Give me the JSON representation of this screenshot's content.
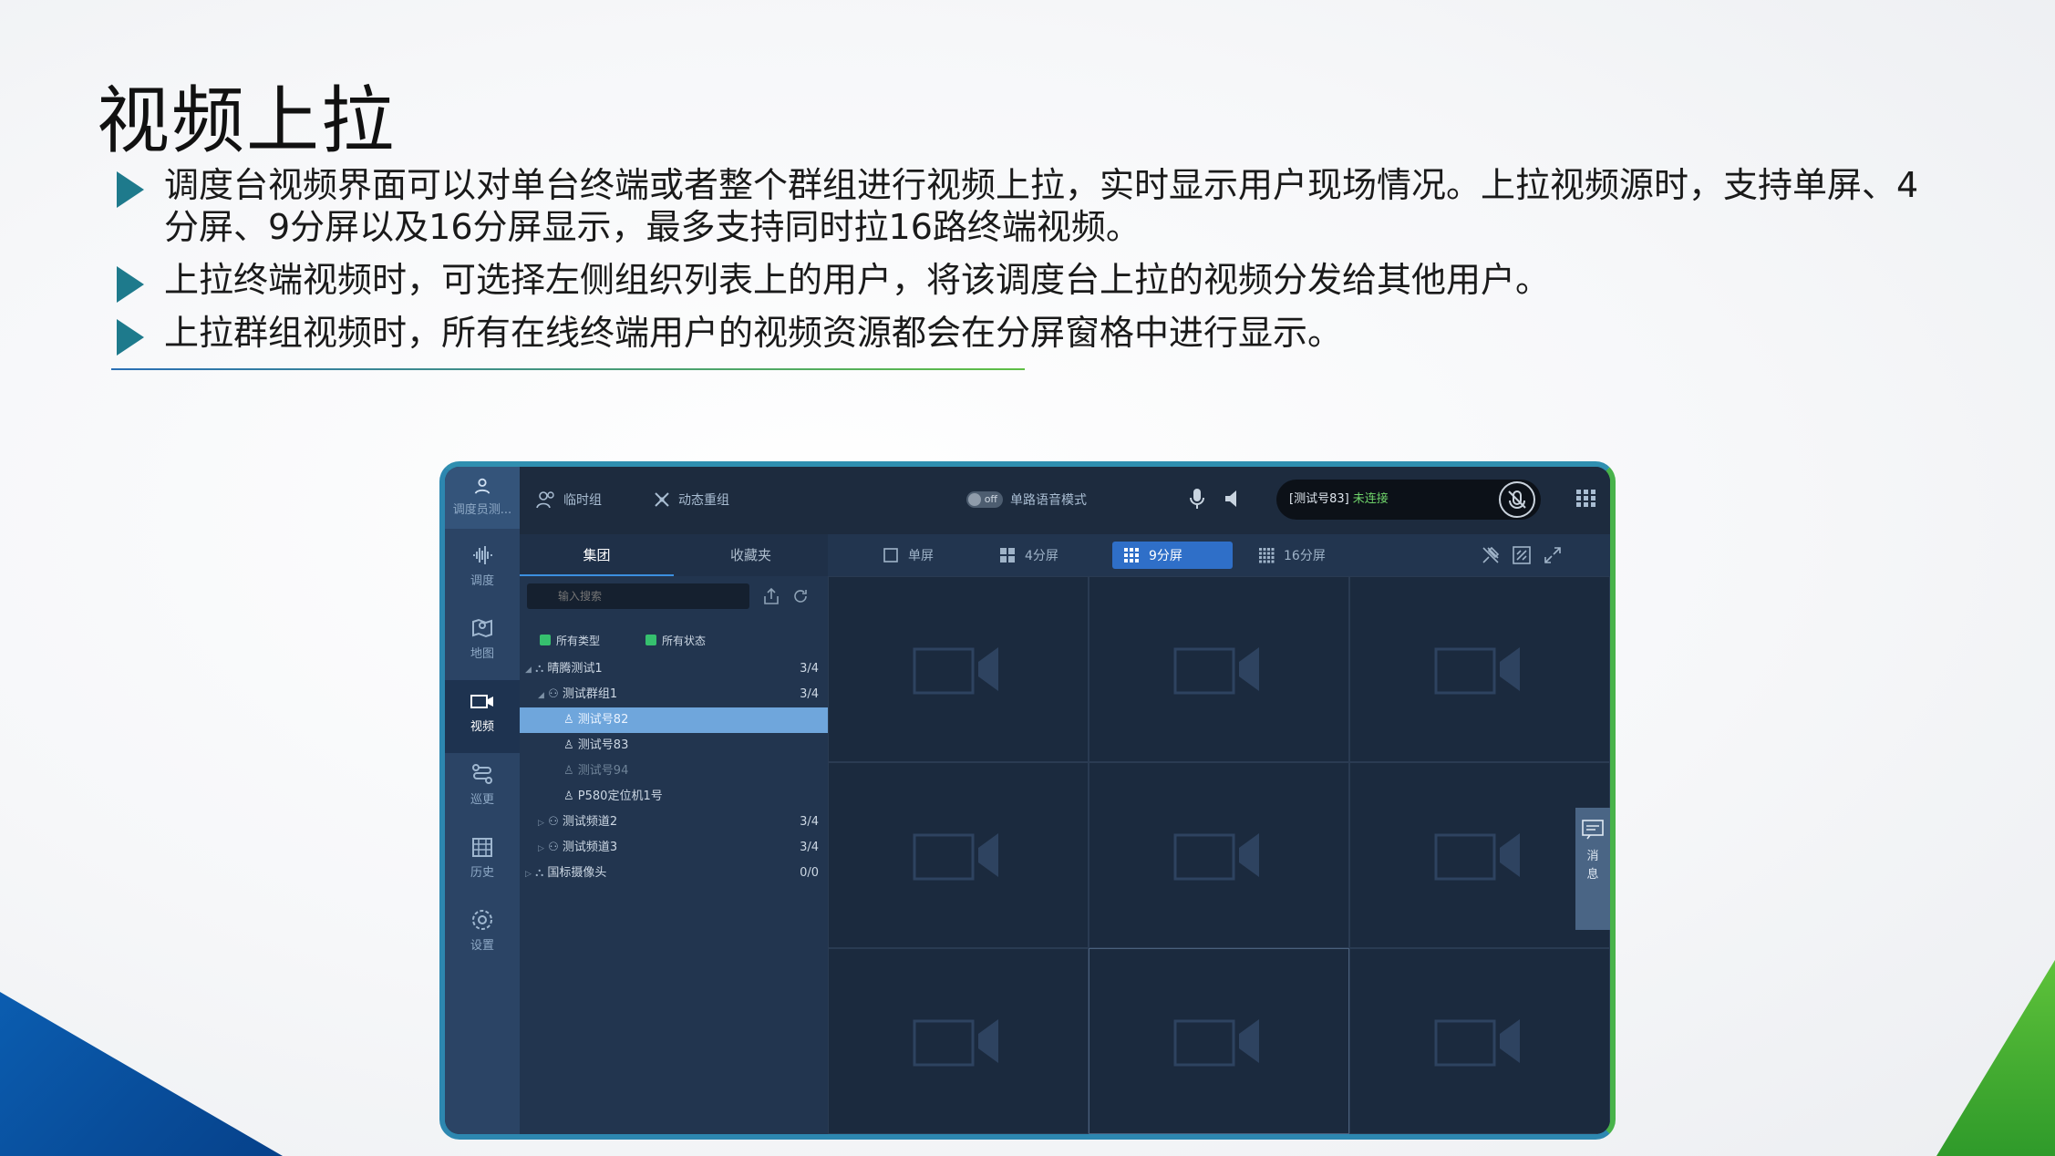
{
  "slide": {
    "title": "视频上拉",
    "bullets": [
      "调度台视频界面可以对单台终端或者整个群组进行视频上拉，实时显示用户现场情况。上拉视频源时，支持单屏、4分屏、9分屏以及16分屏显示，最多支持同时拉16路终端视频。",
      "上拉终端视频时，可选择左侧组织列表上的用户，将该调度台上拉的视频分发给其他用户。",
      "上拉群组视频时，所有在线终端用户的视频资源都会在分屏窗格中进行显示。"
    ]
  },
  "app": {
    "nav": {
      "user": "调度员测...",
      "dispatch": "调度",
      "map": "地图",
      "video": "视频",
      "patrol": "巡更",
      "history": "历史",
      "settings": "设置"
    },
    "topbar": {
      "temp_group": "临时组",
      "dynamic_regroup": "动态重组",
      "toggle_state": "off",
      "single_voice_mode": "单路语音模式",
      "status_name": "[测试号83]",
      "status_state": "未连接"
    },
    "panel": {
      "tabs": [
        "集团",
        "收藏夹"
      ],
      "search_placeholder": "输入搜索",
      "filter_type": "所有类型",
      "filter_state": "所有状态",
      "tree": [
        {
          "label": "晴腾测试1",
          "count": "3/4"
        },
        {
          "label": "测试群组1",
          "count": "3/4"
        },
        {
          "label": "测试号82",
          "count": ""
        },
        {
          "label": "测试号83",
          "count": ""
        },
        {
          "label": "测试号94",
          "count": ""
        },
        {
          "label": "P580定位机1号",
          "count": ""
        },
        {
          "label": "测试频道2",
          "count": "3/4"
        },
        {
          "label": "测试频道3",
          "count": "3/4"
        },
        {
          "label": "国标摄像头",
          "count": "0/0"
        }
      ]
    },
    "layouts": {
      "single": "单屏",
      "four": "4分屏",
      "nine": "9分屏",
      "sixteen": "16分屏"
    },
    "message_tab": "消\n息"
  }
}
